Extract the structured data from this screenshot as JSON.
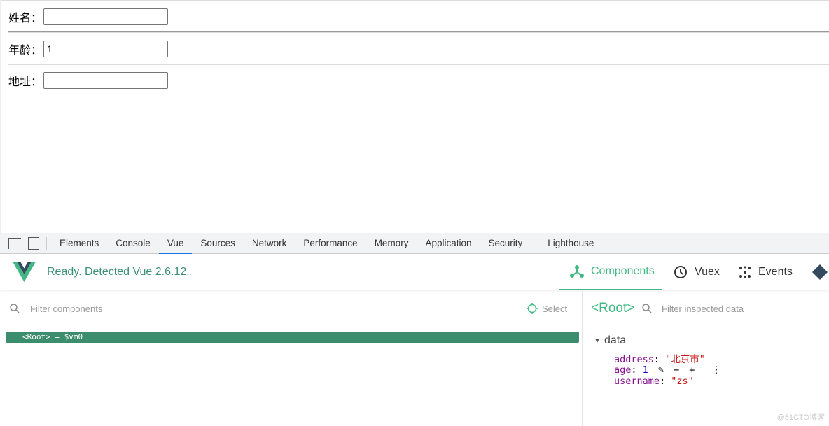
{
  "form": {
    "fields": [
      {
        "label": "姓名：",
        "value": ""
      },
      {
        "label": "年龄：",
        "value": "1"
      },
      {
        "label": "地址：",
        "value": ""
      }
    ]
  },
  "devtools": {
    "tabs": [
      "Elements",
      "Console",
      "Vue",
      "Sources",
      "Network",
      "Performance",
      "Memory",
      "Application",
      "Security",
      "Lighthouse"
    ],
    "active_tab": "Vue"
  },
  "vue": {
    "status": "Ready. Detected Vue 2.6.12.",
    "nav": [
      "Components",
      "Vuex",
      "Events"
    ],
    "active_nav": "Components",
    "accent": "#42b983",
    "filter_components_placeholder": "Filter components",
    "select_label": "Select",
    "root_row": "<Root> = $vm0",
    "inspector": {
      "title": "<Root>",
      "filter_placeholder": "Filter inspected data",
      "section": "data",
      "props": [
        {
          "key": "address",
          "value": "\"北京市\""
        },
        {
          "key": "age",
          "value": "1"
        },
        {
          "key": "username",
          "value": "\"zs\""
        }
      ]
    }
  },
  "watermark": "@51CTO博客"
}
